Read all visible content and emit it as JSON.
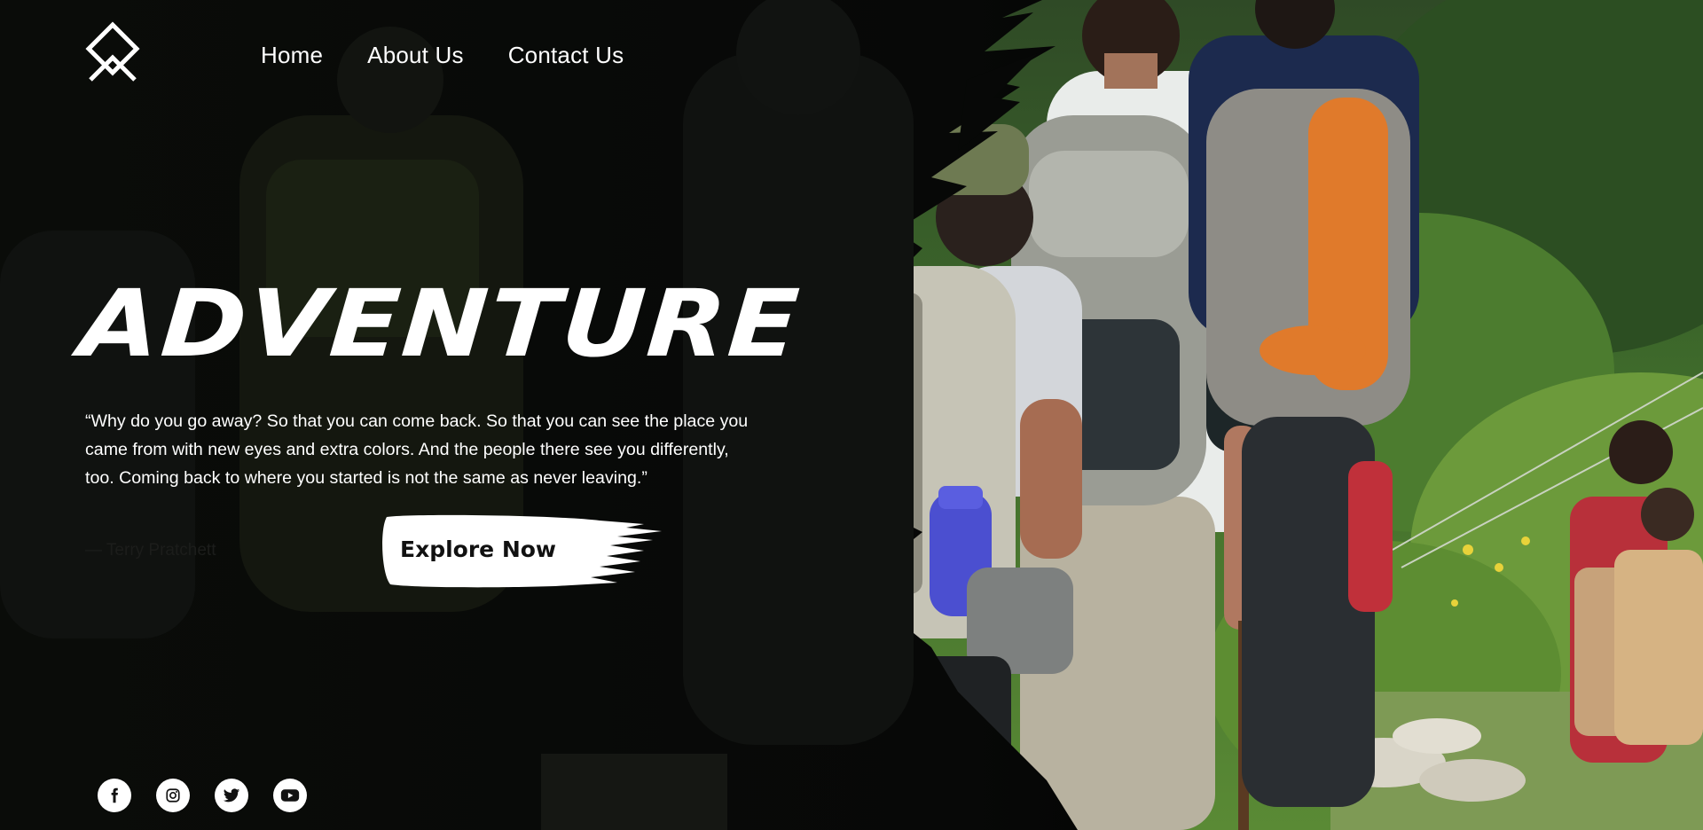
{
  "nav": {
    "logo": "diamond-mountain-logo",
    "links": [
      {
        "label": "Home"
      },
      {
        "label": "About Us"
      },
      {
        "label": "Contact Us"
      }
    ]
  },
  "hero": {
    "title": "ADVENTURE",
    "quote": "“Why do you go away? So that you can come back. So that you can see the place you came from with new eyes and extra colors. And the people there see you differently, too. Coming back to where you started is not the same as never leaving.”",
    "author": "— Terry Pratchett",
    "cta_label": "Explore Now"
  },
  "social": [
    {
      "icon": "facebook-icon"
    },
    {
      "icon": "instagram-icon"
    },
    {
      "icon": "twitter-icon"
    },
    {
      "icon": "youtube-icon"
    }
  ],
  "colors": {
    "overlay": "#0b0d0a",
    "text": "#ffffff",
    "foliage": "#3f6b2c",
    "pack_orange": "#e07a2b",
    "bottle_blue": "#4b4fd0"
  }
}
